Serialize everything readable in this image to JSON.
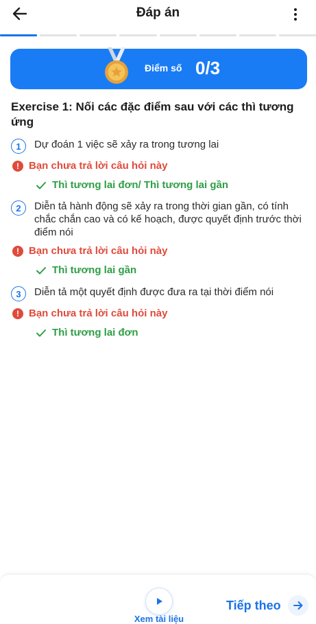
{
  "header": {
    "title": "Đáp án",
    "back_icon": "arrow-left-icon",
    "menu_icon": "more-vertical-icon"
  },
  "progress": {
    "total_segments": 8,
    "active_segments": 1
  },
  "score": {
    "label": "Điểm số",
    "value": "0/3",
    "banner_color": "#1a7cf5"
  },
  "exercise": {
    "title": "Exercise 1: Nối các đặc điểm sau với các thì tương ứng"
  },
  "questions": [
    {
      "number": "1",
      "text": "Dự đoán 1 việc sẽ xảy ra trong tương lai",
      "status": "Bạn chưa trả lời câu hỏi này",
      "answer": "Thì tương lai đơn/ Thì tương lai gần"
    },
    {
      "number": "2",
      "text": "Diễn tả hành động sẽ xảy ra trong thời gian gần, có tính chắc chắn cao và có kế hoạch, được quyết định trước thời điểm nói",
      "status": "Bạn chưa trả lời câu hỏi này",
      "answer": "Thì tương lai gần"
    },
    {
      "number": "3",
      "text": "Diễn tả một quyết định được đưa ra tại thời điểm nói",
      "status": "Bạn chưa trả lời câu hỏi này",
      "answer": "Thì tương lai đơn"
    }
  ],
  "bottom": {
    "doc_label": "Xem tài liệu",
    "next_label": "Tiếp theo"
  },
  "colors": {
    "accent": "#1a73e8",
    "error": "#e04a3b",
    "success": "#2e9e45"
  }
}
